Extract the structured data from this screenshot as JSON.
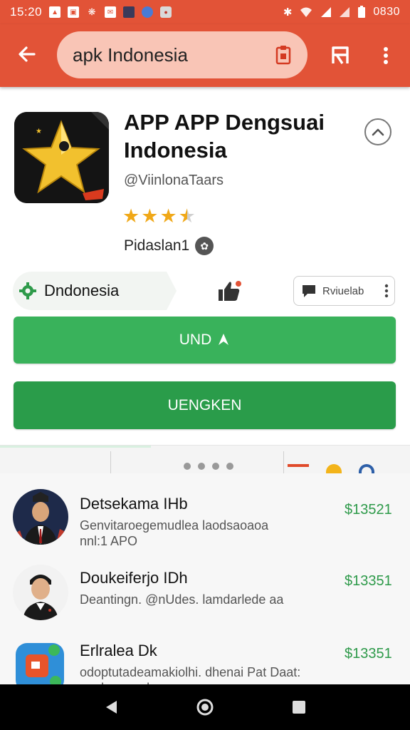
{
  "status_bar": {
    "time": "15:20",
    "battery_text": "0830"
  },
  "toolbar": {
    "search_query": "apk Indonesia"
  },
  "app": {
    "title": "APP APP Dengsuai Indonesia",
    "developer": "@ViinlonaTaars",
    "rating": 3.5,
    "category": "Pidaslan1"
  },
  "actions": {
    "region_label": "Dndonesia",
    "review_label": "Rviuelab",
    "install_label": "UND",
    "open_label": "UENGKEN"
  },
  "list": {
    "items": [
      {
        "title": "Detsekama IHb",
        "description": "Genvitaroegemudlea laodsaoaoa nnl:1 APO",
        "price": "$13521"
      },
      {
        "title": "Doukeiferjo IDh",
        "description": "Deantingn. @nUdes. lamdarlede aa",
        "price": "$13351"
      },
      {
        "title": "Erlralea Dk",
        "description": "odoptutadeamakiolhi. dhenai Pat Daat: anakaeumulna",
        "price": "$13351"
      }
    ]
  },
  "colors": {
    "toolbar": "#e25337",
    "search_bg": "#f9c5b6",
    "install_button": "#39b25b",
    "open_button": "#2a9c4a",
    "price": "#2e9a4a",
    "star": "#f0a818"
  },
  "icons": {
    "back": "arrow-left-icon",
    "clip": "clipboard-icon",
    "bookmark": "bookmark-icon",
    "more": "more-vert-icon",
    "collapse": "chevron-up-icon",
    "region": "gear-icon",
    "like": "thumbs-up-icon",
    "review": "comment-icon",
    "install": "arrow-up-icon"
  }
}
